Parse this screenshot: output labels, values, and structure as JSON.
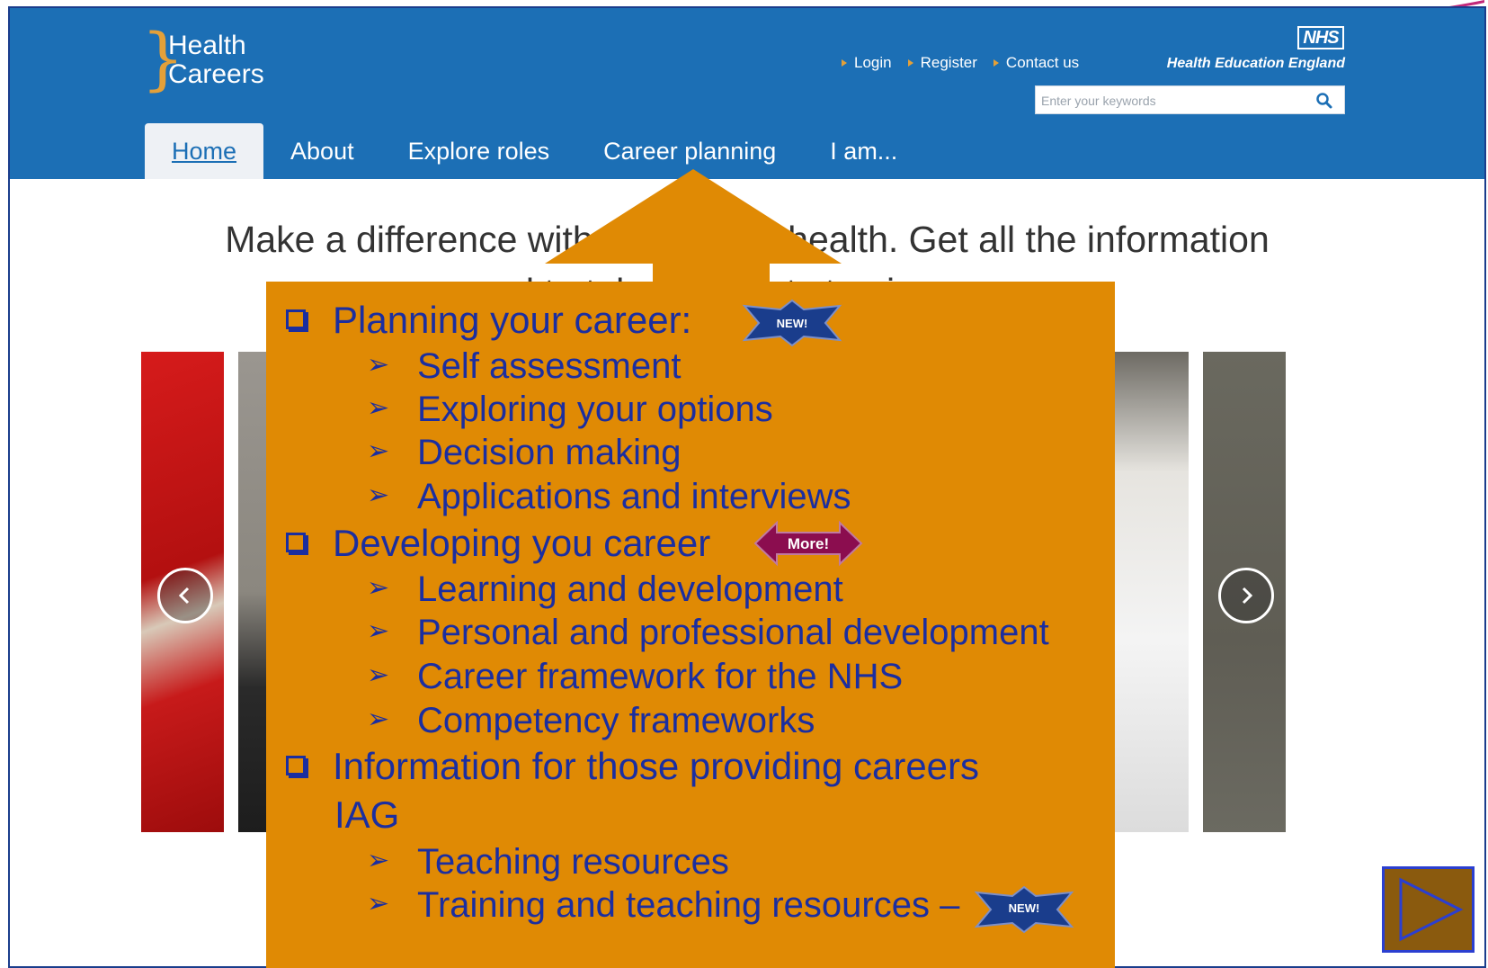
{
  "logo": {
    "line1": "Health",
    "line2": "Careers"
  },
  "header": {
    "links": [
      "Login",
      "Register",
      "Contact us"
    ],
    "nhs": "NHS",
    "org": "Health Education England",
    "search_placeholder": "Enter your keywords"
  },
  "nav": {
    "items": [
      "Home",
      "About",
      "Explore roles",
      "Career planning",
      "I am..."
    ],
    "active": "Home"
  },
  "tagline": {
    "line1": "Make a difference with a career in health. Get all the information",
    "line2": "you need to take the next step in your career"
  },
  "overlay": {
    "items": [
      {
        "level": 1,
        "text": "Planning your career:"
      },
      {
        "level": 2,
        "text": "Self assessment"
      },
      {
        "level": 2,
        "text": "Exploring your options"
      },
      {
        "level": 2,
        "text": "Decision making"
      },
      {
        "level": 2,
        "text": "Applications and interviews"
      },
      {
        "level": 1,
        "text": "Developing you career"
      },
      {
        "level": 2,
        "text": "Learning and development"
      },
      {
        "level": 2,
        "text": "Personal and professional development"
      },
      {
        "level": 2,
        "text": "Career framework for the NHS"
      },
      {
        "level": 2,
        "text": "Competency frameworks"
      },
      {
        "level": 1,
        "text": "Information for those providing careers"
      },
      {
        "level": 1,
        "text": "IAG"
      },
      {
        "level": 2,
        "text": "Teaching resources"
      },
      {
        "level": 2,
        "text": "Training and teaching resources –"
      }
    ],
    "badges": {
      "new1": "NEW!",
      "more": "More!",
      "new2": "NEW!"
    }
  },
  "colors": {
    "header_blue": "#1c6fb5",
    "overlay_orange": "#e08a04",
    "overlay_text": "#1b2ea0",
    "accent": "#e3a039",
    "more_badge": "#8b0d4f",
    "new_badge": "#1a3d8c"
  },
  "icons": {
    "search": "search-icon",
    "prev": "chevron-left-icon",
    "next": "chevron-right-icon",
    "play": "play-icon"
  }
}
